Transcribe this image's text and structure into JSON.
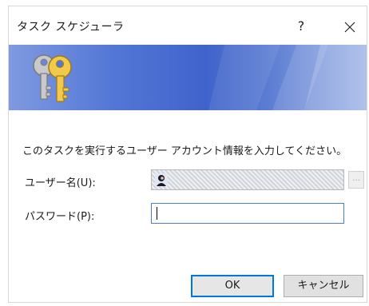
{
  "window": {
    "title": "タスク スケジューラ",
    "help_label": "?"
  },
  "dialog": {
    "instruction": "このタスクを実行するユーザー アカウント情報を入力してください。",
    "username_label": "ユーザー名(U):",
    "password_label": "パスワード(P):",
    "username_value": "",
    "password_value": "",
    "browse_label": "..."
  },
  "buttons": {
    "ok": "OK",
    "cancel": "キャンセル"
  },
  "icons": {
    "banner": "keys-icon",
    "user": "user-avatar-icon",
    "close": "close-icon"
  },
  "colors": {
    "banner_blue": "#3f63cc",
    "focus_border": "#0078d7"
  }
}
